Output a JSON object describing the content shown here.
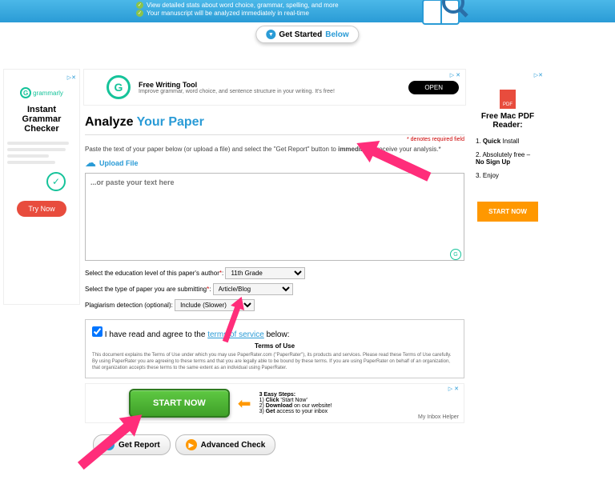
{
  "banner": {
    "bullet1": "View detailed stats about word choice, grammar, spelling, and more",
    "bullet2": "Your manuscript will be analyzed immediately in real-time",
    "getStarted": "Get Started",
    "below": "Below"
  },
  "leftAd": {
    "tag": "▷✕",
    "brand": "grammarly",
    "heading": "Instant Grammar Checker",
    "tryNow": "Try Now"
  },
  "topAd": {
    "title": "Free Writing Tool",
    "sub": "Improve grammar, word choice, and sentence structure in your writing. It's free!",
    "open": "OPEN",
    "mark": "▷ ✕"
  },
  "analyze": {
    "titleA": "Analyze ",
    "titleB": "Your Paper",
    "reqNote": "* denotes required field",
    "inst1": "Paste the text of your paper below (or upload a file) and select the \"Get Report\" button to ",
    "instBold": "immediately",
    "inst2": " receive your analysis.*",
    "upload": "Upload File",
    "placeholder": "...or paste your text here",
    "eduLabel": "Select the education level of this paper's author",
    "eduVal": "11th Grade",
    "typeLabel": "Select the type of paper you are submitting",
    "typeVal": "Article/Blog",
    "plagLabel": "Plagiarism detection (optional):",
    "plagVal": "Include (Slower)"
  },
  "tos": {
    "agree1": "I have read and agree to the ",
    "agreeLink": "terms of service",
    "agree2": " below:",
    "heading": "Terms of Use",
    "text": "This document explains the Terms of Use under which you may use PaperRater.com (\"PaperRater\"), its products and services. Please read these Terms of Use carefully. By using PaperRater you are agreeing to these terms and that you are legally able to be bound by these terms. If you are using PaperRater on behalf of an organization, that organization accepts these terms to the same extent as an individual using PaperRater."
  },
  "bottomAd": {
    "startNow": "START NOW",
    "stepsTitle": "3 Easy Steps:",
    "s1a": "1) ",
    "s1b": "Click",
    "s1c": " 'Start Now'",
    "s2a": "2) ",
    "s2b": "Download",
    "s2c": " on our website!",
    "s3a": "3) ",
    "s3b": "Get",
    "s3c": " access to your inbox",
    "inbox": "My Inbox Helper",
    "mark": "▷ ✕"
  },
  "buttons": {
    "getReport": "Get Report",
    "advCheck": "Advanced Check"
  },
  "rightAd": {
    "tag": "▷✕",
    "pdf": "PDF",
    "title": "Free Mac PDF Reader:",
    "i1a": "1. ",
    "i1b": "Quick",
    "i1c": " Install",
    "i2": "2. Absolutely free –",
    "i2b": "No Sign Up",
    "i3": "3. Enjoy",
    "start": "START NOW"
  }
}
